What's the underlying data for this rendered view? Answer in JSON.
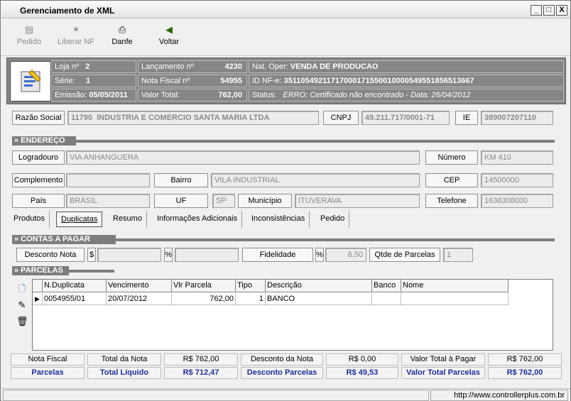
{
  "window": {
    "title": "Gerenciamento de XML",
    "min": "_",
    "max": "□",
    "close": "X"
  },
  "toolbar": {
    "pedido": "Pedido",
    "liberar": "Liberar NF",
    "danfe": "Danfe",
    "voltar": "Voltar"
  },
  "header": {
    "loja_label": "Loja nº",
    "loja": "2",
    "serie_label": "Série:",
    "serie": "1",
    "emissao_label": "Emissão:",
    "emissao": "05/05/2011",
    "lanc_label": "Lançamento nº",
    "lanc": "4230",
    "nf_label": "Nota Fiscal nº",
    "nf": "54955",
    "valor_label": "Valor Total:",
    "valor": "762,00",
    "natoper_label": "Nat. Oper:",
    "natoper": "VENDA DE PRODUCAO",
    "idnfe_label": "ID NF-e:",
    "idnfe": "35110549211717000171550010000549551856513667",
    "status_label": "Status:",
    "status": "ERRO: Certificado não encontrado - Data: 26/04/2012"
  },
  "supplier": {
    "razao_label": "Razão Social",
    "codigo": "11790",
    "razao": "INDUSTRIA E COMERCIO SANTA MARIA LTDA",
    "cnpj_label": "CNPJ",
    "cnpj": "49.211.717/0001-71",
    "ie_label": "IE",
    "ie": "389007207110"
  },
  "endereco": {
    "title": "» ENDEREÇO",
    "logradouro_label": "Logradouro",
    "logradouro": "VIA ANHANGUERA",
    "numero_label": "Número",
    "numero": "KM 410",
    "complemento_label": "Complemento",
    "complemento": "",
    "bairro_label": "Bairro",
    "bairro": "VILA INDUSTRIAL",
    "cep_label": "CEP",
    "cep": "14500000",
    "pais_label": "País",
    "pais": "BRASIL",
    "uf_label": "UF",
    "uf": "SP",
    "municipio_label": "Município",
    "municipio": "ITUVERAVA",
    "telefone_label": "Telefone",
    "telefone": "1638308000"
  },
  "tabs": [
    "Produtos",
    "Duplicatas",
    "Resumo",
    "Informações Adicionais",
    "Inconsistências",
    "Pedido"
  ],
  "contas": {
    "title": "» CONTAS A PAGAR",
    "desconto_label": "Desconto Nota",
    "dollar": "$",
    "pct": "%",
    "fidelidade_label": "Fidelidade",
    "pct2": "%",
    "fidelidade": "6,50",
    "qtde_label": "Qtde de Parcelas",
    "qtde": "1"
  },
  "parcelas": {
    "title": "» PARCELAS",
    "columns": [
      "N.Duplicata",
      "Vencimento",
      "Vlr Parcela",
      "Tipo",
      "Descrição",
      "Banco",
      "Nome"
    ],
    "rows": [
      {
        "dup": "0054955/01",
        "venc": "20/07/2012",
        "vlr": "762,00",
        "tipo": "1",
        "desc": "BANCO",
        "banco": "",
        "nome": ""
      }
    ]
  },
  "totais": {
    "nf_label": "Nota Fiscal",
    "total_nota_label": "Total da Nota",
    "total_nota": "R$ 762,00",
    "desc_nota_label": "Desconto da Nota",
    "desc_nota": "R$ 0,00",
    "vtp_label": "Valor Total à Pagar",
    "vtp": "R$ 762,00",
    "parcelas_label": "Parcelas",
    "total_liq_label": "Total Líquido",
    "total_liq": "R$ 712,47",
    "desc_parc_label": "Desconto Parcelas",
    "desc_parc": "R$ 49,53",
    "vtparc_label": "Valor Total Parcelas",
    "vtparc": "R$ 762,00"
  },
  "statusbar": {
    "url": "http://www.controllerplus.com.br"
  }
}
